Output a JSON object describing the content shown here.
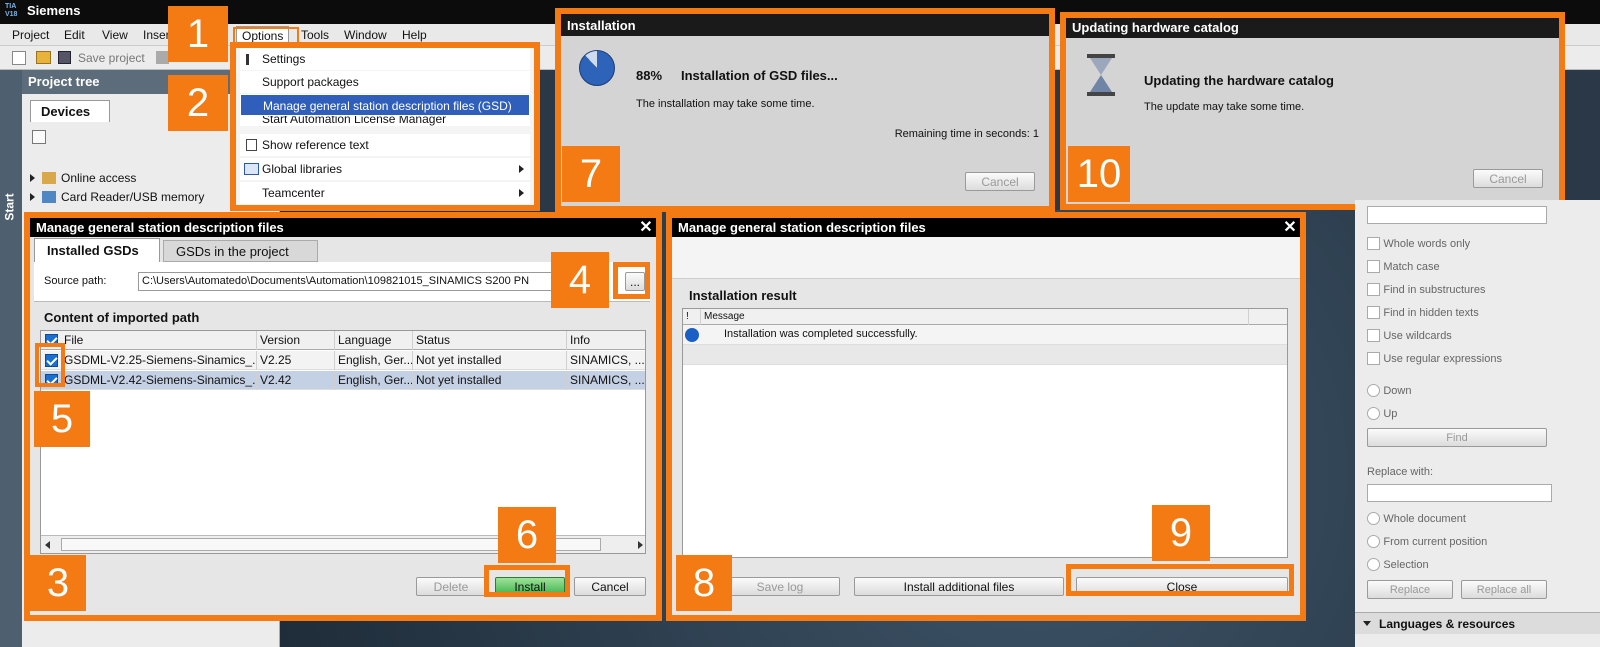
{
  "app": {
    "title": "Siemens",
    "logo": "TIA V18"
  },
  "menubar": [
    "Project",
    "Edit",
    "View",
    "Insert",
    "Options",
    "Tools",
    "Window",
    "Help"
  ],
  "toolbar": {
    "save_label": "Save project"
  },
  "project_tree": {
    "title": "Project tree",
    "tab": "Devices",
    "items": [
      "Online access",
      "Card Reader/USB memory"
    ]
  },
  "side_tab": "Start",
  "options_menu": {
    "items": [
      "Settings",
      "Support packages",
      "Manage general station description files (GSD)",
      "Start Automation License Manager",
      "Show reference text",
      "Global libraries",
      "Teamcenter"
    ]
  },
  "badges": [
    "1",
    "2",
    "3",
    "4",
    "5",
    "6",
    "7",
    "8",
    "9",
    "10"
  ],
  "install_dialog": {
    "title": "Installation",
    "percent": "88%",
    "heading": "Installation of GSD files...",
    "subtext": "The installation may take some time.",
    "remaining": "Remaining time in seconds: 1",
    "cancel": "Cancel",
    "progress_fraction": 0.88
  },
  "catalog_dialog": {
    "title": "Updating hardware catalog",
    "heading": "Updating the hardware catalog",
    "subtext": "The update may take some time.",
    "cancel": "Cancel"
  },
  "gsd_dialog": {
    "title": "Manage general station description files",
    "tabs": [
      "Installed GSDs",
      "GSDs in the project"
    ],
    "source_label": "Source path:",
    "source_value": "C:\\Users\\Automatedo\\Documents\\Automation\\109821015_SINAMICS S200 PN",
    "browse": "...",
    "content_title": "Content of imported path",
    "columns": [
      "File",
      "Version",
      "Language",
      "Status",
      "Info"
    ],
    "rows": [
      {
        "file": "GSDML-V2.25-Siemens-Sinamics_...",
        "version": "V2.25",
        "language": "English, Ger...",
        "status": "Not yet installed",
        "info": "SINAMICS, ..."
      },
      {
        "file": "GSDML-V2.42-Siemens-Sinamics_...",
        "version": "V2.42",
        "language": "English, Ger...",
        "status": "Not yet installed",
        "info": "SINAMICS, ..."
      }
    ],
    "buttons": {
      "delete": "Delete",
      "install": "Install",
      "cancel": "Cancel"
    }
  },
  "result_dialog": {
    "title": "Manage general station description files",
    "section": "Installation result",
    "columns": [
      "!",
      "Message"
    ],
    "message": "Installation was completed successfully.",
    "buttons": {
      "save_log": "Save log",
      "install_more": "Install additional files",
      "close": "Close"
    }
  },
  "find_panel": {
    "options": [
      "Whole words only",
      "Match case",
      "Find in substructures",
      "Find in hidden texts",
      "Use wildcards",
      "Use regular expressions"
    ],
    "direction": [
      "Down",
      "Up"
    ],
    "find_btn": "Find",
    "replace_label": "Replace with:",
    "scope": [
      "Whole document",
      "From current position",
      "Selection"
    ],
    "replace_btn": "Replace",
    "replace_all_btn": "Replace all",
    "languages": "Languages & resources"
  }
}
